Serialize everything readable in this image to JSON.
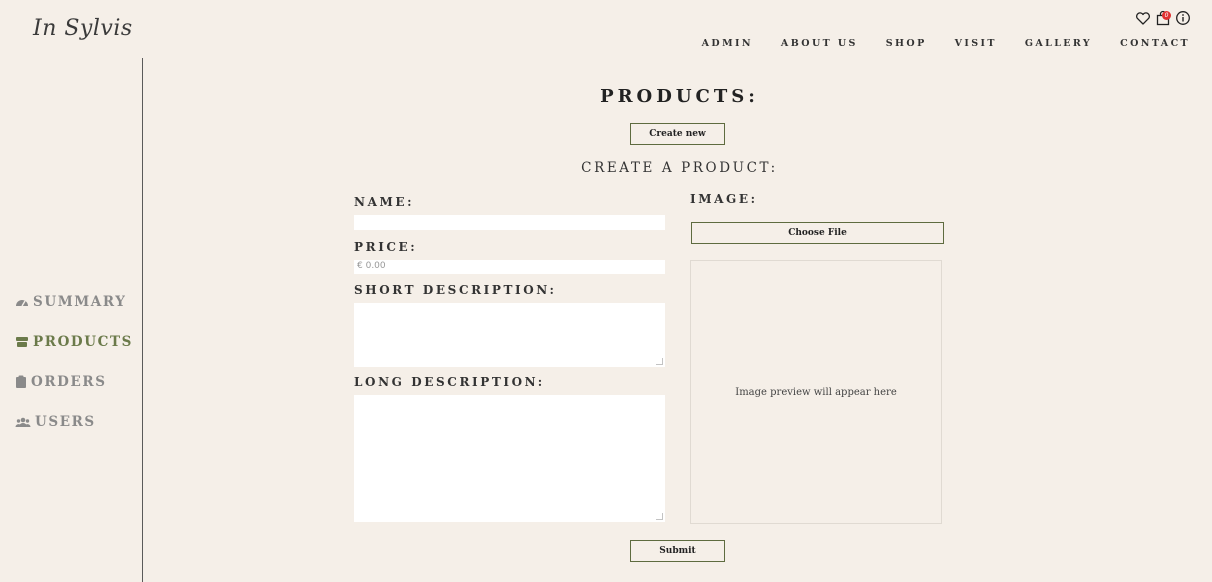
{
  "logo": "In Sylvis",
  "header": {
    "nav": [
      "ADMIN",
      "ABOUT US",
      "SHOP",
      "VISIT",
      "GALLERY",
      "CONTACT"
    ],
    "icons": [
      "heart-icon",
      "shopping-bag-icon",
      "info-icon"
    ],
    "cart_badge": "0"
  },
  "sidebar": {
    "items": [
      {
        "label": "SUMMARY",
        "icon": "dashboard-icon"
      },
      {
        "label": "PRODUCTS",
        "icon": "store-icon"
      },
      {
        "label": "ORDERS",
        "icon": "clipboard-icon"
      },
      {
        "label": "USERS",
        "icon": "users-icon"
      }
    ],
    "active": "PRODUCTS"
  },
  "main": {
    "title": "PRODUCTS:",
    "create_new": "Create new",
    "form_title": "CREATE A PRODUCT:",
    "name_label": "NAME:",
    "price_label": "PRICE:",
    "price_placeholder": "€ 0.00",
    "short_desc_label": "SHORT DESCRIPTION:",
    "long_desc_label": "LONG DESCRIPTION:",
    "image_label": "IMAGE:",
    "choose_file": "Choose File",
    "preview_text": "Image preview will appear here",
    "submit": "Submit"
  },
  "colors": {
    "background": "#f5efe8",
    "accent": "#6b7a4a"
  }
}
